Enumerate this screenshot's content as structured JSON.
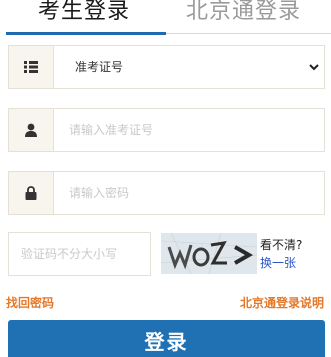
{
  "tabs": {
    "candidate_login": "考生登录",
    "beijingtong_login": "北京通登录"
  },
  "form": {
    "id_type_selected": "准考证号",
    "id_placeholder": "请输入准考证号",
    "password_placeholder": "请输入密码",
    "captcha_placeholder": "验证码不分大小写",
    "captcha_unclear": "看不清?",
    "captcha_refresh": "换一张"
  },
  "links": {
    "forgot_password": "找回密码",
    "beijingtong_help": "北京通登录说明"
  },
  "login_button": "登录",
  "icons": {
    "id_type": "list-icon",
    "user": "user-icon",
    "password": "lock-icon",
    "select": "chevron-down-icon"
  },
  "colors": {
    "accent": "#1f71b4",
    "link_orange": "#e4792a",
    "link_blue": "#2a56c6"
  }
}
